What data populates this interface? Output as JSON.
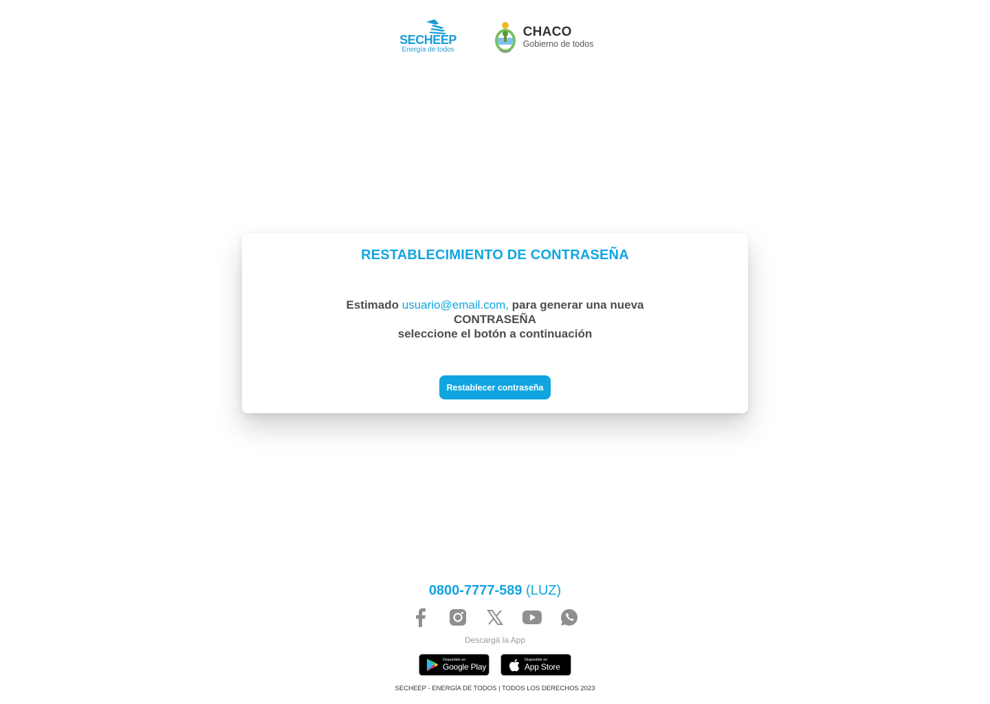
{
  "header": {
    "secheep_name": "SECHEEP",
    "secheep_tagline": "Energía de todos",
    "chaco_title": "CHACO",
    "chaco_subtitle": "Gobierno de todos"
  },
  "card": {
    "title": "RESTABLECIMIENTO DE CONTRASEÑA",
    "greeting": "Estimado ",
    "email": "usuario@email.com,",
    "message_rest": " para generar una nueva CONTRASEÑA",
    "message_line2": "seleccione el botón a continuación",
    "button_label": "Restablecer contraseña"
  },
  "footer": {
    "phone_number": "0800-7777-589",
    "phone_suffix": " (LUZ)",
    "social_icons": [
      "facebook-icon",
      "instagram-icon",
      "x-icon",
      "youtube-icon",
      "whatsapp-icon"
    ],
    "download_label": "Descargá la App",
    "google_play_small": "Disponible en",
    "google_play_big": "Google Play",
    "app_store_small": "Disponible en",
    "app_store_big": "App Store",
    "copyright": "SECHEEP - ENERGÍA DE TODOS | TODOS LOS DERECHOS 2023"
  },
  "colors": {
    "accent": "#10a5e0",
    "text": "#4d4d4d",
    "icon_gray": "#8f8f8f"
  }
}
